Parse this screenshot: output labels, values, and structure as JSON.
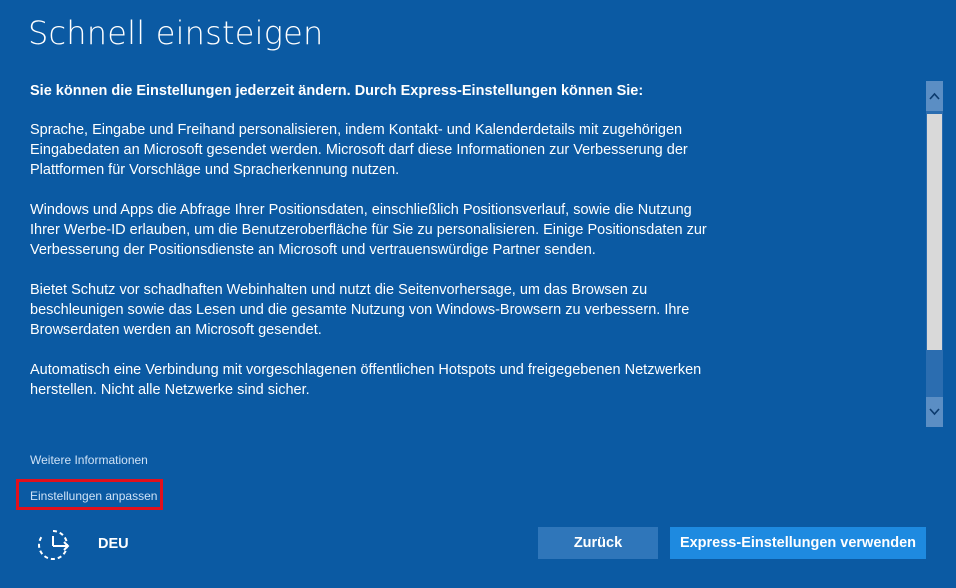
{
  "title": "Schnell einsteigen",
  "intro": "Sie können die Einstellungen jederzeit ändern. Durch Express-Einstellungen können Sie:",
  "paragraphs": [
    "Sprache, Eingabe und Freihand personalisieren, indem Kontakt- und Kalenderdetails mit zugehörigen Eingabedaten an Microsoft gesendet werden. Microsoft darf diese Informationen zur Verbesserung der Plattformen für Vorschläge und Spracherkennung nutzen.",
    "Windows und Apps die Abfrage Ihrer Positionsdaten, einschließlich Positionsverlauf, sowie die Nutzung Ihrer Werbe-ID erlauben, um die Benutzeroberfläche für Sie zu personalisieren. Einige Positionsdaten zur Verbesserung der Positionsdienste an Microsoft und vertrauenswürdige Partner senden.",
    "Bietet Schutz vor schadhaften Webinhalten und nutzt die Seitenvorhersage, um das Browsen zu beschleunigen sowie das Lesen und die gesamte Nutzung von Windows-Browsern zu verbessern. Ihre Browserdaten werden an Microsoft gesendet.",
    "Automatisch eine Verbindung mit vorgeschlagenen öffentlichen Hotspots und freigegebenen Netzwerken herstellen. Nicht alle Netzwerke sind sicher."
  ],
  "links": {
    "more_info": "Weitere Informationen",
    "customize": "Einstellungen anpassen"
  },
  "footer": {
    "language": "DEU",
    "ease_icon": "ease-of-access-icon"
  },
  "buttons": {
    "back": "Zurück",
    "express": "Express-Einstellungen verwenden"
  },
  "colors": {
    "background": "#0b5aa3",
    "primary_button": "#1e8ae0",
    "secondary_button": "#2f76ba",
    "highlight": "#e3101c"
  }
}
